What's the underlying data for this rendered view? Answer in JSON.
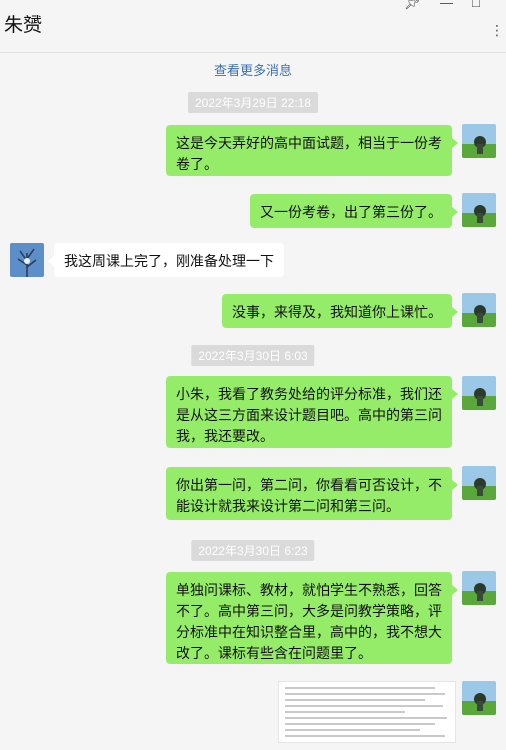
{
  "header": {
    "contact_name": "朱赟",
    "pin_icon": "pin-icon",
    "minimize_icon": "minimize-icon",
    "maximize_icon": "maximize-icon",
    "more_icon": "more-dots-icon"
  },
  "load_more": "查看更多消息",
  "colors": {
    "my_bubble": "#95ec69",
    "their_bubble": "#ffffff",
    "link": "#3d6fb0",
    "timestamp_bg": "#dadada"
  },
  "timestamps": [
    "2022年3月29日 22:18",
    "2022年3月30日 6:03",
    "2022年3月30日 6:23"
  ],
  "messages": [
    {
      "sender": "me",
      "text": "这是今天弄好的高中面试题，相当于一份考卷了。"
    },
    {
      "sender": "me",
      "text": "又一份考卷，出了第三份了。"
    },
    {
      "sender": "other",
      "text": "我这周课上完了，刚准备处理一下"
    },
    {
      "sender": "me",
      "text": "没事，来得及，我知道你上课忙。"
    },
    {
      "sender": "me",
      "text": "小朱，我看了教务处给的评分标准，我们还是从这三方面来设计题目吧。高中的第三问我，我还要改。"
    },
    {
      "sender": "me",
      "text": "你出第一问，第二问，你看看可否设计，不能设计就我来设计第二问和第三问。"
    },
    {
      "sender": "me",
      "text": "单独问课标、教材，就怕学生不熟悉，回答不了。高中第三问，大多是问教学策略，评分标准中在知识整合里，高中的，我不想大改了。课标有些含在问题里了。"
    },
    {
      "sender": "me",
      "type": "document-image"
    }
  ]
}
